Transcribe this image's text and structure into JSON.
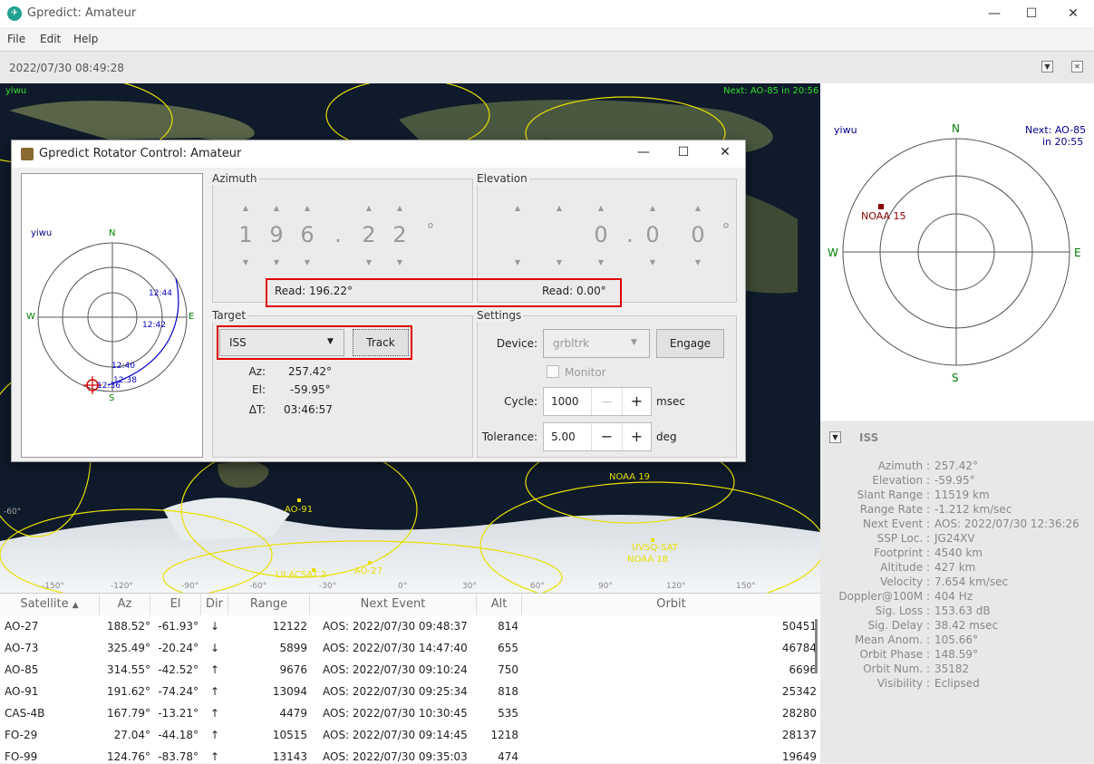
{
  "window": {
    "title": "Gpredict: Amateur",
    "minimize": "—",
    "maximize": "☐",
    "close": "✕"
  },
  "menu": {
    "file": "File",
    "edit": "Edit",
    "help": "Help"
  },
  "timebar": {
    "datetime": "2022/07/30 08:49:28"
  },
  "map": {
    "qth": "yiwu",
    "next": "Next: AO-85 in 20:56",
    "sats": [
      "NOAA 19",
      "AO-91",
      "UVSQ-SAT",
      "NOAA 18",
      "LILACSAT 2",
      "AO-27"
    ],
    "lon_labels": [
      "-150°",
      "-120°",
      "-90°",
      "-60°",
      "-30°",
      "0°",
      "30°",
      "60°",
      "90°",
      "120°",
      "150°"
    ],
    "lat_labels": [
      "-60°"
    ]
  },
  "polar_right": {
    "qth": "yiwu",
    "next_line1": "Next: AO-85",
    "next_line2": "in 20:55",
    "n": "N",
    "s": "S",
    "e": "E",
    "w": "W",
    "sat": "NOAA 15"
  },
  "iss_panel": {
    "title": "ISS",
    "rows": [
      {
        "label": "Azimuth :",
        "value": "257.42°"
      },
      {
        "label": "Elevation :",
        "value": "-59.95°"
      },
      {
        "label": "Slant Range :",
        "value": "11519 km"
      },
      {
        "label": "Range Rate :",
        "value": "-1.212 km/sec"
      },
      {
        "label": "Next Event :",
        "value": "AOS: 2022/07/30 12:36:26"
      },
      {
        "label": "SSP Loc. :",
        "value": "JG24XV"
      },
      {
        "label": "Footprint :",
        "value": "4540 km"
      },
      {
        "label": "Altitude :",
        "value": "427 km"
      },
      {
        "label": "Velocity :",
        "value": "7.654 km/sec"
      },
      {
        "label": "Doppler@100M :",
        "value": "404 Hz"
      },
      {
        "label": "Sig. Loss :",
        "value": "153.63 dB"
      },
      {
        "label": "Sig. Delay :",
        "value": "38.42 msec"
      },
      {
        "label": "Mean Anom. :",
        "value": "105.66°"
      },
      {
        "label": "Orbit Phase :",
        "value": "148.59°"
      },
      {
        "label": "Orbit Num. :",
        "value": "35182"
      },
      {
        "label": "Visibility :",
        "value": "Eclipsed"
      }
    ]
  },
  "table": {
    "headers": {
      "satellite": "Satellite",
      "az": "Az",
      "el": "El",
      "dir": "Dir",
      "range": "Range",
      "next_event": "Next Event",
      "alt": "Alt",
      "orbit": "Orbit"
    },
    "rows": [
      {
        "sat": "AO-27",
        "az": "188.52°",
        "el": "-61.93°",
        "dir": "↓",
        "range": "12122",
        "next": "AOS: 2022/07/30 09:48:37",
        "alt": "814",
        "orbit": "50451"
      },
      {
        "sat": "AO-73",
        "az": "325.49°",
        "el": "-20.24°",
        "dir": "↓",
        "range": "5899",
        "next": "AOS: 2022/07/30 14:47:40",
        "alt": "655",
        "orbit": "46784"
      },
      {
        "sat": "AO-85",
        "az": "314.55°",
        "el": "-42.52°",
        "dir": "↑",
        "range": "9676",
        "next": "AOS: 2022/07/30 09:10:24",
        "alt": "750",
        "orbit": "6696"
      },
      {
        "sat": "AO-91",
        "az": "191.62°",
        "el": "-74.24°",
        "dir": "↑",
        "range": "13094",
        "next": "AOS: 2022/07/30 09:25:34",
        "alt": "818",
        "orbit": "25342"
      },
      {
        "sat": "CAS-4B",
        "az": "167.79°",
        "el": "-13.21°",
        "dir": "↑",
        "range": "4479",
        "next": "AOS: 2022/07/30 10:30:45",
        "alt": "535",
        "orbit": "28280"
      },
      {
        "sat": "FO-29",
        "az": "27.04°",
        "el": "-44.18°",
        "dir": "↑",
        "range": "10515",
        "next": "AOS: 2022/07/30 09:14:45",
        "alt": "1218",
        "orbit": "28137"
      },
      {
        "sat": "FO-99",
        "az": "124.76°",
        "el": "-83.78°",
        "dir": "↑",
        "range": "13143",
        "next": "AOS: 2022/07/30 09:35:03",
        "alt": "474",
        "orbit": "19649"
      }
    ]
  },
  "rotator": {
    "title": "Gpredict Rotator Control: Amateur",
    "polar": {
      "qth": "yiwu",
      "n": "N",
      "s": "S",
      "e": "E",
      "w": "W",
      "t1": "12:44",
      "t2": "12:42",
      "t3": "12:40",
      "t4": "12:38",
      "t5": "12:36"
    },
    "azimuth": {
      "label": "Azimuth",
      "digits": [
        "1",
        "9",
        "6",
        ".",
        "2",
        "2",
        "°"
      ],
      "read": "Read: 196.22°"
    },
    "elevation": {
      "label": "Elevation",
      "digits": [
        "0",
        ".",
        "0",
        "0",
        "°"
      ],
      "read": "Read:  0.00°"
    },
    "target": {
      "label": "Target",
      "sat": "ISS",
      "track": "Track",
      "az_label": "Az:",
      "az": "257.42°",
      "el_label": "El:",
      "el": "-59.95°",
      "dt_label": "ΔT:",
      "dt": "03:46:57"
    },
    "settings": {
      "label": "Settings",
      "device_label": "Device:",
      "device": "grbltrk",
      "engage": "Engage",
      "monitor": "Monitor",
      "cycle_label": "Cycle:",
      "cycle": "1000",
      "cycle_unit": "msec",
      "tol_label": "Tolerance:",
      "tol": "5.00",
      "tol_unit": "deg",
      "minus": "—",
      "minus2": "−",
      "plus": "+"
    }
  },
  "colors": {
    "accent_red": "#e00000",
    "map_track": "#e8e000",
    "polar_track": "#0000c8"
  }
}
